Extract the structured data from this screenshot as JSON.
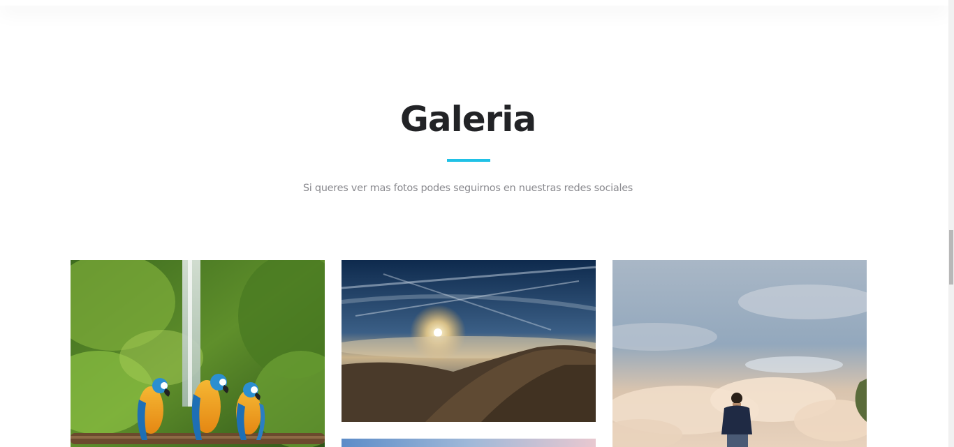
{
  "gallery": {
    "title": "Galeria",
    "subtitle": "Si queres ver mas fotos podes seguirnos en nuestras redes sociales",
    "accent_color": "#20c1e6",
    "photos": [
      {
        "subject": "macaws-waterfall-photo"
      },
      {
        "subject": "mountain-sunset-photo"
      },
      {
        "subject": "man-cliff-sky-photo"
      },
      {
        "subject": "sky-photo-partial"
      }
    ]
  }
}
